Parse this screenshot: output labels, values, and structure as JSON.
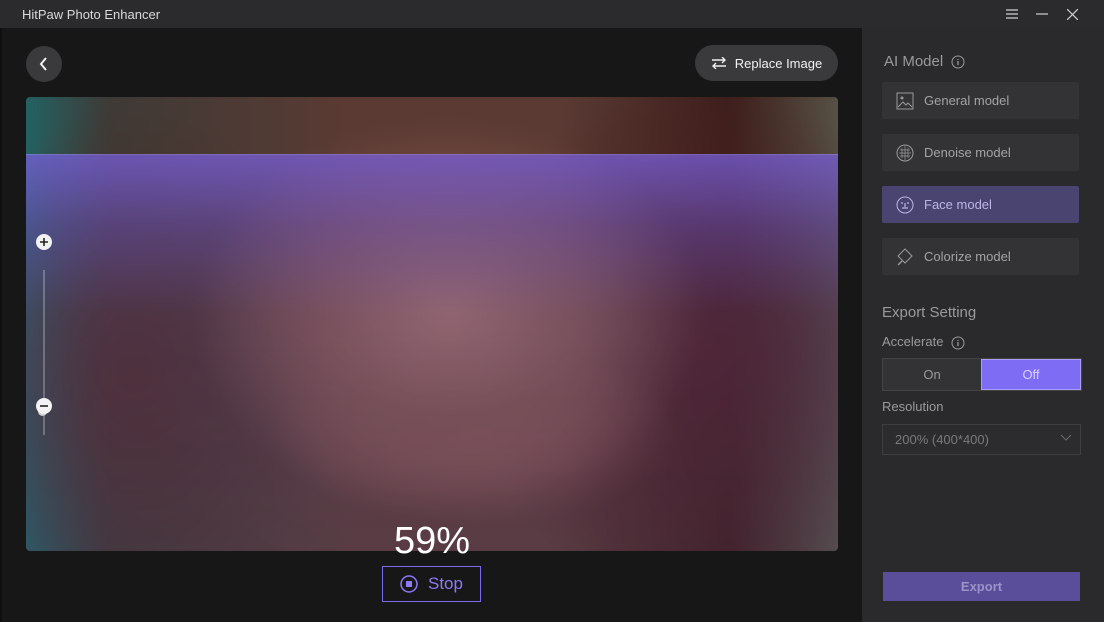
{
  "app": {
    "title": "HitPaw Photo Enhancer"
  },
  "toolbar": {
    "replace_label": "Replace Image"
  },
  "preview": {
    "progress_text": "59%",
    "progress_fraction": 0.59
  },
  "actions": {
    "stop_label": "Stop"
  },
  "sidebar": {
    "ai_model_title": "AI Model",
    "models": [
      {
        "label": "General model",
        "icon": "image-icon",
        "active": false
      },
      {
        "label": "Denoise model",
        "icon": "denoise-icon",
        "active": false
      },
      {
        "label": "Face model",
        "icon": "face-icon",
        "active": true
      },
      {
        "label": "Colorize model",
        "icon": "paint-bucket-icon",
        "active": false
      }
    ],
    "export_title": "Export Setting",
    "accelerate_label": "Accelerate",
    "accelerate_options": [
      "On",
      "Off"
    ],
    "accelerate_selected": "Off",
    "resolution_label": "Resolution",
    "resolution_value": "200% (400*400)",
    "export_label": "Export"
  },
  "colors": {
    "accent": "#7e6cf5",
    "panel_bg": "#2a2a2c",
    "main_bg": "#171718"
  }
}
